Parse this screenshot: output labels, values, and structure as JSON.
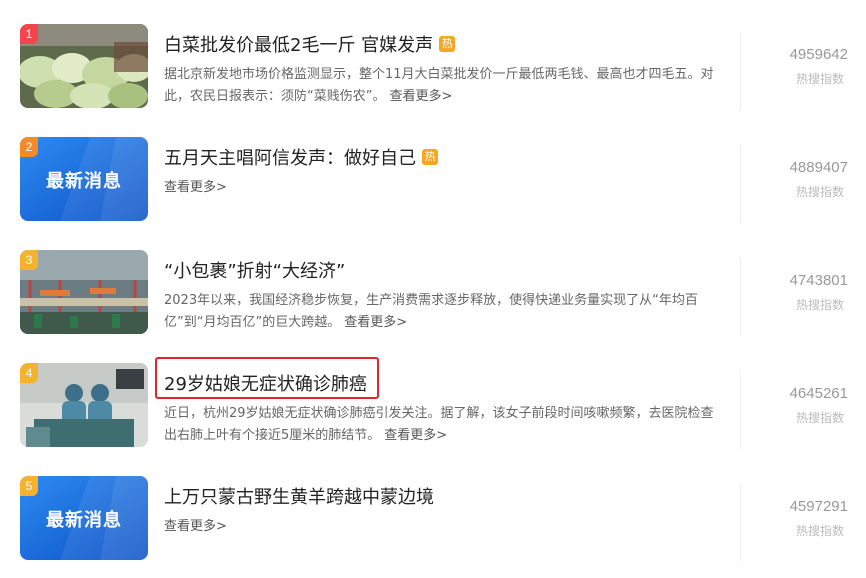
{
  "colors": {
    "rank_1": "#f2454c",
    "rank_2": "#f58a2b",
    "rank_3": "#f5b22b",
    "rank_4": "#f5b22b",
    "rank_5": "#f5b22b",
    "hot_badge": "#f5a623",
    "highlight": "#e0252b"
  },
  "items": [
    {
      "rank": "1",
      "title": "白菜批发价最低2毛一斤 官媒发声",
      "hot": "热",
      "desc": "据北京新发地市场价格监测显示，整个11月大白菜批发价一斤最低两毛钱、最高也才四毛五。对此，农民日报表示：须防“菜贱伤农”。",
      "more": "查看更多>",
      "score": "4959642",
      "score_label": "热搜指数",
      "thumb_icon": "cabbage-photo"
    },
    {
      "rank": "2",
      "title": "五月天主唱阿信发声：做好自己",
      "hot": "热",
      "thumb_text": "最新消息",
      "more": "查看更多>",
      "score": "4889407",
      "score_label": "热搜指数"
    },
    {
      "rank": "3",
      "title": "“小包裹”折射“大经济”",
      "desc": "2023年以来，我国经济稳步恢复，生产消费需求逐步释放，使得快递业务量实现了从“年均百亿”到“月均百亿”的巨大跨越。",
      "more": "查看更多>",
      "score": "4743801",
      "score_label": "热搜指数",
      "thumb_icon": "warehouse-photo"
    },
    {
      "rank": "4",
      "title": "29岁姑娘无症状确诊肺癌",
      "desc": "近日，杭州29岁姑娘无症状确诊肺癌引发关注。据了解，该女子前段时间咳嗽频繁，去医院检查出右肺上叶有个接近5厘米的肺结节。",
      "more": "查看更多>",
      "score": "4645261",
      "score_label": "热搜指数",
      "thumb_icon": "surgery-photo"
    },
    {
      "rank": "5",
      "title": "上万只蒙古野生黄羊跨越中蒙边境",
      "thumb_text": "最新消息",
      "more": "查看更多>",
      "score": "4597291",
      "score_label": "热搜指数"
    }
  ]
}
